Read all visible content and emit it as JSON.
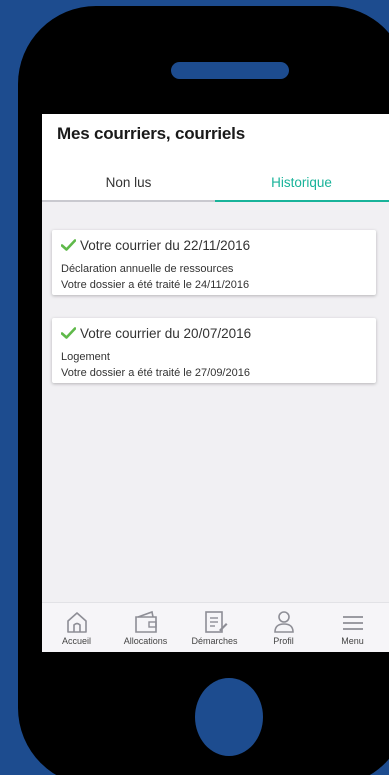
{
  "header": {
    "title": "Mes courriers, courriels"
  },
  "tabs": [
    {
      "label": "Non lus",
      "active": false
    },
    {
      "label": "Historique",
      "active": true
    }
  ],
  "colors": {
    "accent": "#19b39a",
    "check": "#5fb94a",
    "background": "#1d4c8f"
  },
  "letters": [
    {
      "title": "Votre courrier du 22/11/2016",
      "subject": "Déclaration annuelle de ressources",
      "status": "Votre dossier a été traité le 24/11/2016",
      "icon": "check-icon"
    },
    {
      "title": "Votre courrier du 20/07/2016",
      "subject": "Logement",
      "status": "Votre dossier a été traité le 27/09/2016",
      "icon": "check-icon"
    }
  ],
  "bottom_nav": [
    {
      "label": "Accueil",
      "icon": "home-icon"
    },
    {
      "label": "Allocations",
      "icon": "wallet-icon"
    },
    {
      "label": "Démarches",
      "icon": "document-edit-icon"
    },
    {
      "label": "Profil",
      "icon": "user-icon"
    },
    {
      "label": "Menu",
      "icon": "menu-icon"
    }
  ]
}
